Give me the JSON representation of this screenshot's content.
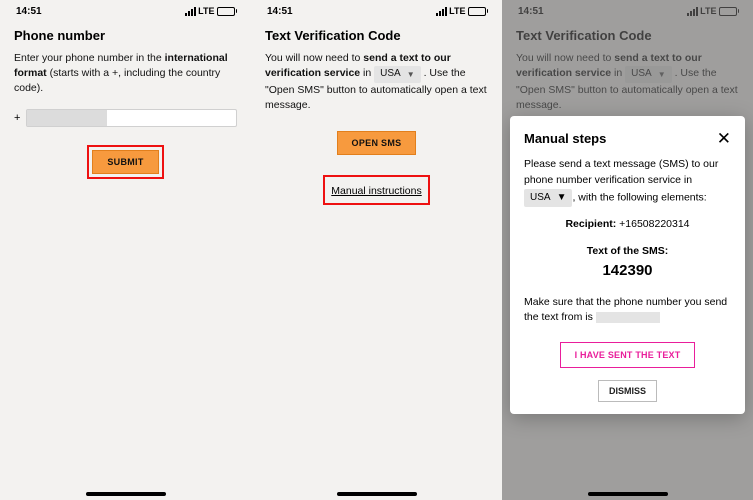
{
  "statusbar": {
    "time": "14:51",
    "network": "LTE"
  },
  "screen1": {
    "title": "Phone number",
    "body_prefix": "Enter your phone number in the ",
    "body_bold": "international format",
    "body_suffix": " (starts with a +, including the country code).",
    "plus_label": "+",
    "submit_label": "SUBMIT"
  },
  "screen2": {
    "title": "Text Verification Code",
    "body_prefix": "You will now need to ",
    "body_bold": "send a text to our verification service",
    "body_mid": " in ",
    "country": "USA",
    "body_after_country": " . Use the \"Open SMS\" button to automatically open a text message.",
    "open_sms_label": "OPEN SMS",
    "manual_instructions_label": "Manual instructions"
  },
  "screen3": {
    "title": "Text Verification Code",
    "body_prefix": "You will now need to ",
    "body_bold": "send a text to our verification service",
    "body_mid": " in ",
    "country": "USA",
    "body_after_country": " . Use the \"Open SMS\" button to automatically open a text message.",
    "modal": {
      "title": "Manual steps",
      "p1": "Please send a text message (SMS) to our phone number verification service in",
      "country": "USA",
      "p1_suffix": ", with the following elements:",
      "recipient_label": "Recipient:",
      "recipient_value": "+16508220314",
      "sms_text_label": "Text of the SMS:",
      "sms_code": "142390",
      "p2_prefix": "Make sure that the phone number you send the text from is ",
      "sent_button": "I HAVE SENT THE TEXT",
      "dismiss_button": "DISMISS"
    }
  }
}
